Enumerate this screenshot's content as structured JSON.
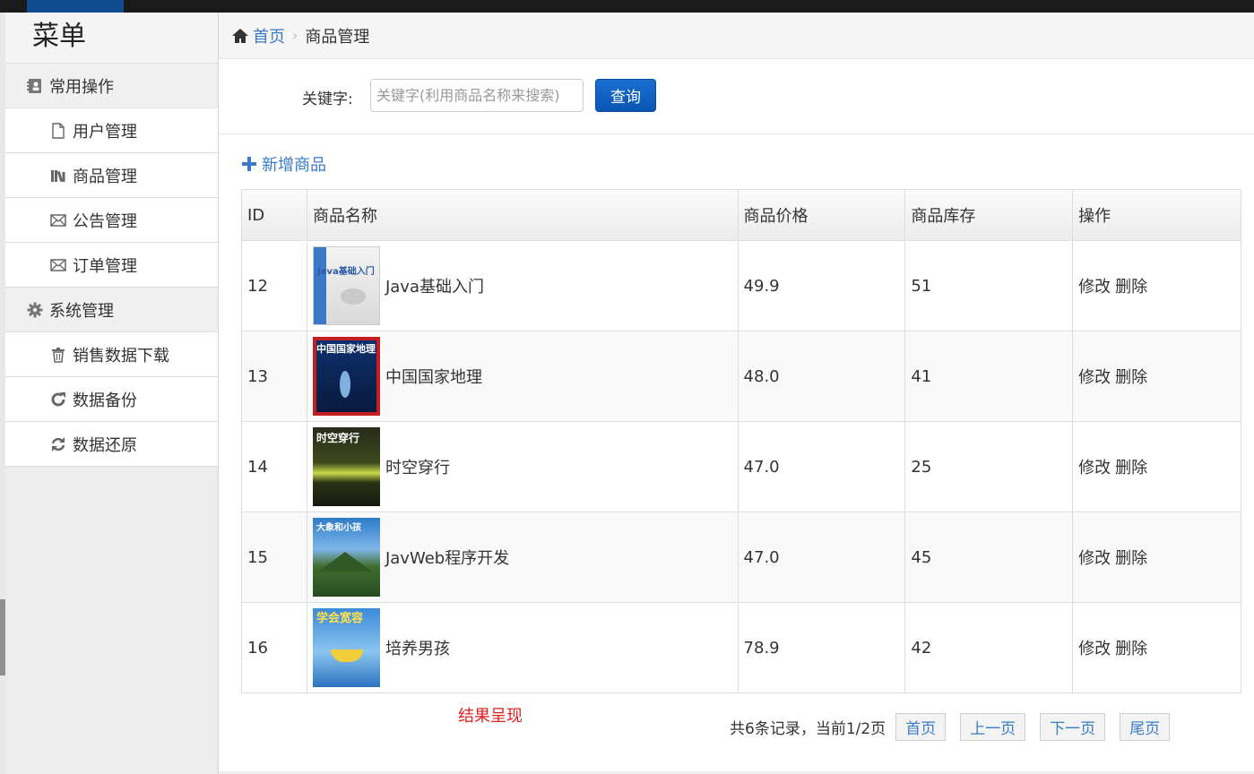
{
  "sidebar": {
    "title": "菜单",
    "groups": [
      {
        "label": "常用操作",
        "icon": "address-book-icon",
        "items": [
          {
            "label": "用户管理",
            "icon": "file-icon"
          },
          {
            "label": "商品管理",
            "icon": "books-icon"
          },
          {
            "label": "公告管理",
            "icon": "envelope-icon"
          },
          {
            "label": "订单管理",
            "icon": "envelope-icon"
          }
        ]
      },
      {
        "label": "系统管理",
        "icon": "gear-icon",
        "items": [
          {
            "label": "销售数据下载",
            "icon": "trash-icon"
          },
          {
            "label": "数据备份",
            "icon": "refresh-icon"
          },
          {
            "label": "数据还原",
            "icon": "sync-icon"
          }
        ]
      }
    ]
  },
  "breadcrumb": {
    "home": "首页",
    "current": "商品管理"
  },
  "search": {
    "label": "关键字:",
    "placeholder": "关键字(利用商品名称来搜索)",
    "button": "查询"
  },
  "add_link": "新增商品",
  "table": {
    "headers": [
      "ID",
      "商品名称",
      "商品价格",
      "商品库存",
      "操作"
    ],
    "rows": [
      {
        "id": "12",
        "name": "Java基础入门",
        "price": "49.9",
        "stock": "51",
        "cover_text": "Java基础入门"
      },
      {
        "id": "13",
        "name": "中国国家地理",
        "price": "48.0",
        "stock": "41",
        "cover_text": "中国国家地理"
      },
      {
        "id": "14",
        "name": "时空穿行",
        "price": "47.0",
        "stock": "25",
        "cover_text": "时空穿行"
      },
      {
        "id": "15",
        "name": "JavWeb程序开发",
        "price": "47.0",
        "stock": "45",
        "cover_text": "大象和小孩"
      },
      {
        "id": "16",
        "name": "培养男孩",
        "price": "78.9",
        "stock": "42",
        "cover_text": "学会宽容"
      }
    ],
    "edit_label": "修改",
    "delete_label": "删除"
  },
  "result_label": "结果呈现",
  "pager": {
    "info": "共6条记录，当前1/2页",
    "first": "首页",
    "prev": "上一页",
    "next": "下一页",
    "last": "尾页"
  },
  "colors": {
    "accent": "#0a55b3",
    "link": "#3a7bc8",
    "result": "#e02020"
  }
}
